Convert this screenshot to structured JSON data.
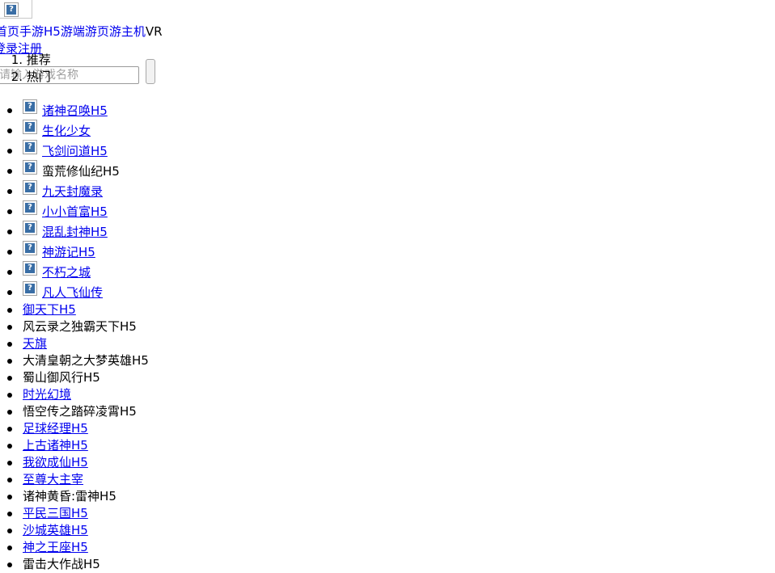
{
  "header": {
    "logo_icon": "broken-image-icon"
  },
  "nav": {
    "items": [
      {
        "label": "首页",
        "link": true
      },
      {
        "label": "手游",
        "link": true
      },
      {
        "label": "H5游",
        "link": true
      },
      {
        "label": "端游",
        "link": true
      },
      {
        "label": "页游",
        "link": true
      },
      {
        "label": "主机",
        "link": true
      },
      {
        "label": "VR",
        "link": false
      }
    ]
  },
  "auth": {
    "login_label": "登录",
    "register_label": "注册"
  },
  "tabs": [
    {
      "num": "1.",
      "label": "推荐"
    },
    {
      "num": "2.",
      "label": "热门"
    }
  ],
  "search": {
    "placeholder": "请输入游戏名称"
  },
  "games_with_image": [
    {
      "label": "诸神召唤H5",
      "link": true
    },
    {
      "label": "生化少女",
      "link": true
    },
    {
      "label": "飞剑问道H5",
      "link": true
    },
    {
      "label": "蛮荒修仙纪H5",
      "link": false
    },
    {
      "label": "九天封魔录",
      "link": true
    },
    {
      "label": "小小首富H5",
      "link": true
    },
    {
      "label": "混乱封神H5",
      "link": true
    },
    {
      "label": "神游记H5",
      "link": true
    },
    {
      "label": "不朽之城",
      "link": true
    },
    {
      "label": "凡人飞仙传",
      "link": true
    }
  ],
  "games_text": [
    {
      "label": "御天下H5",
      "link": true
    },
    {
      "label": "风云录之独霸天下H5",
      "link": false
    },
    {
      "label": "天旗",
      "link": true
    },
    {
      "label": "大清皇朝之大梦英雄H5",
      "link": false
    },
    {
      "label": "蜀山御风行H5",
      "link": false
    },
    {
      "label": "时光幻境",
      "link": true
    },
    {
      "label": "悟空传之踏碎凌霄H5",
      "link": false
    },
    {
      "label": "足球经理H5",
      "link": true
    },
    {
      "label": "上古诸神H5",
      "link": true
    },
    {
      "label": "我欲成仙H5",
      "link": true
    },
    {
      "label": "至尊大主宰",
      "link": true
    },
    {
      "label": "诸神黄昏:雷神H5",
      "link": false
    },
    {
      "label": "平民三国H5",
      "link": true
    },
    {
      "label": "沙城英雄H5",
      "link": true
    },
    {
      "label": "神之王座H5",
      "link": true
    },
    {
      "label": "雷击大作战H5",
      "link": false
    }
  ],
  "colors": {
    "link": "#0000ee",
    "text": "#000000",
    "icon": "#3a6ea5"
  }
}
